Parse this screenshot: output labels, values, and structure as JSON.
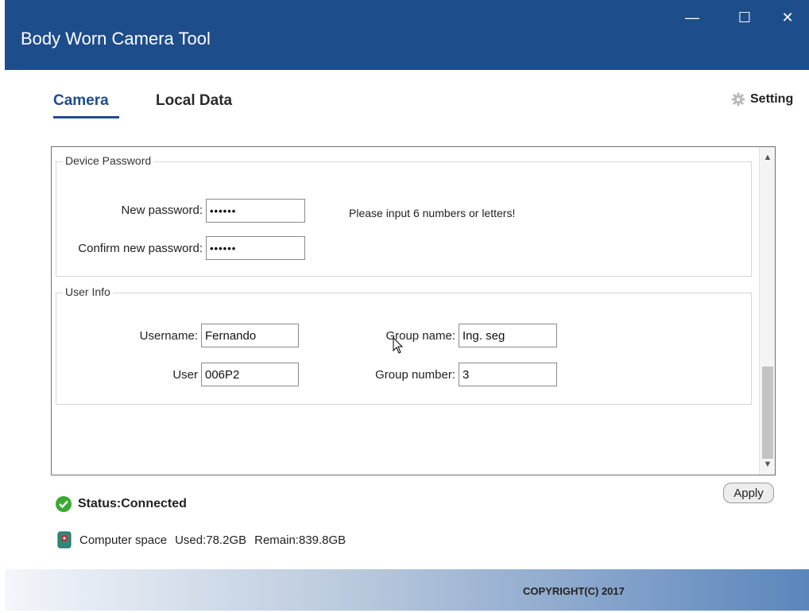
{
  "window": {
    "title": "Body Worn Camera Tool",
    "minimize": "—",
    "maximize": "☐",
    "close": "✕"
  },
  "tabs": [
    {
      "label": "Camera",
      "active": true
    },
    {
      "label": "Local Data",
      "active": false
    }
  ],
  "setting": {
    "label": "Setting",
    "icon": "gear-icon"
  },
  "device_password": {
    "legend": "Device Password",
    "new_label": "New password:",
    "new_value": "••••••",
    "confirm_label": "Confirm new password:",
    "confirm_value": "••••••",
    "hint": "Please input 6 numbers or letters!"
  },
  "user_info": {
    "legend": "User Info",
    "username_label": "Username:",
    "username_value": "Fernando",
    "user_label": "User",
    "user_value": "006P2",
    "group_name_label": "Group name:",
    "group_name_value": "Ing. seg",
    "group_number_label": "Group number:",
    "group_number_value": "3"
  },
  "apply_label": "Apply",
  "status": {
    "text": "Status:Connected",
    "color": "#3aaa35"
  },
  "computer_space": {
    "label": "Computer space",
    "used": "Used:78.2GB",
    "remain": "Remain:839.8GB"
  },
  "footer": {
    "copyright": "COPYRIGHT(C) 2017"
  },
  "colors": {
    "brand": "#1e4d8c"
  }
}
